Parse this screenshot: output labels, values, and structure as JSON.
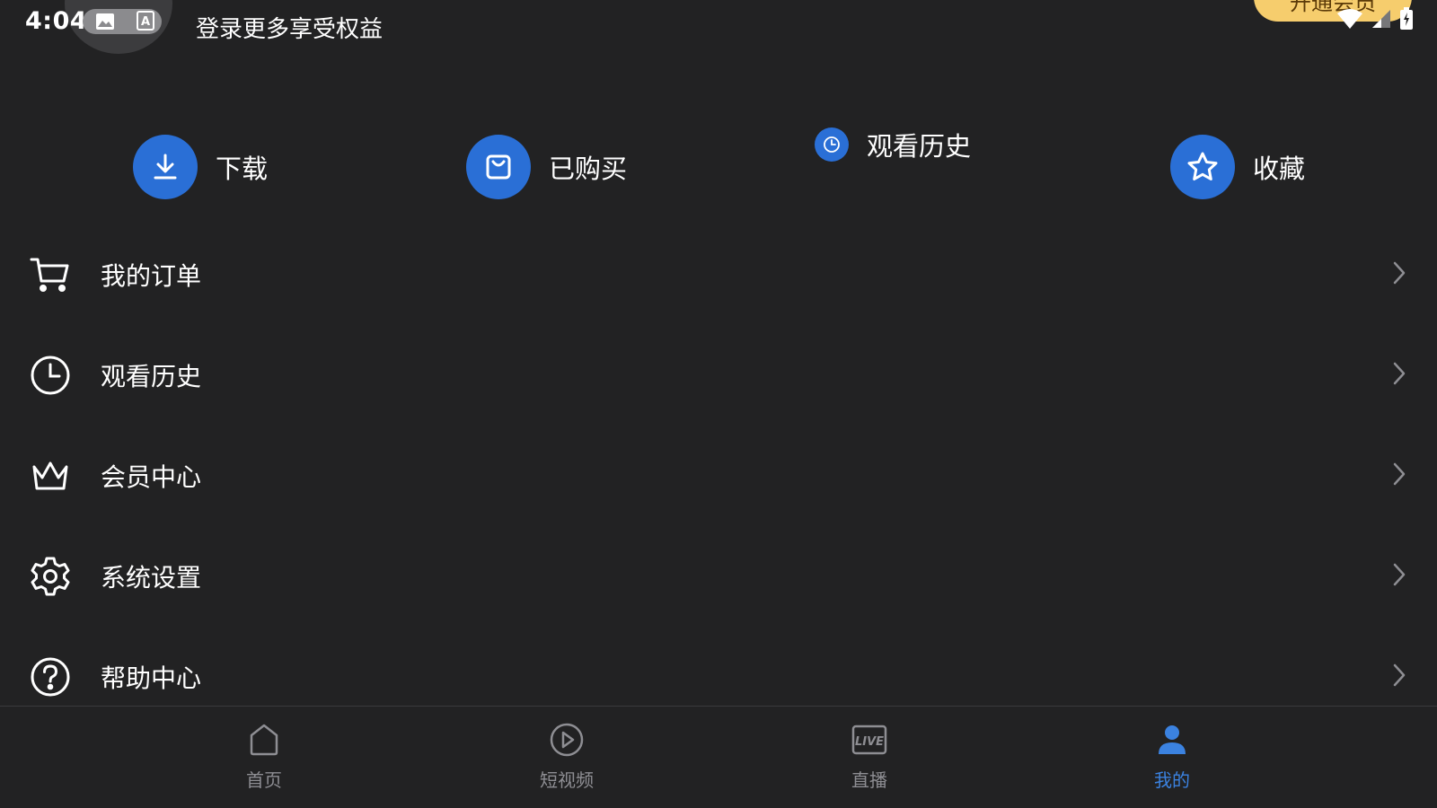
{
  "status_bar": {
    "time": "4:04"
  },
  "header": {
    "login_prompt": "登录更多享受权益",
    "vip_button": "开通会员"
  },
  "quick_actions": [
    {
      "label": "下载",
      "icon": "download-icon"
    },
    {
      "label": "已购买",
      "icon": "bag-icon"
    },
    {
      "label": "观看历史",
      "icon": "clock-icon"
    },
    {
      "label": "收藏",
      "icon": "star-icon"
    }
  ],
  "menu": [
    {
      "label": "我的订单",
      "icon": "cart-icon"
    },
    {
      "label": "观看历史",
      "icon": "clock-icon"
    },
    {
      "label": "会员中心",
      "icon": "crown-icon"
    },
    {
      "label": "系统设置",
      "icon": "gear-icon"
    },
    {
      "label": "帮助中心",
      "icon": "help-icon"
    }
  ],
  "bottom_nav": [
    {
      "label": "首页",
      "icon": "home-icon",
      "active": false
    },
    {
      "label": "短视频",
      "icon": "play-icon",
      "active": false
    },
    {
      "label": "直播",
      "icon": "live-icon",
      "active": false
    },
    {
      "label": "我的",
      "icon": "profile-icon",
      "active": true
    }
  ],
  "colors": {
    "background": "#222223",
    "accent": "#2a6fd6",
    "active_nav": "#3b82e0",
    "vip_gold": "#f6cd6d",
    "inactive_nav": "#8e8e93"
  }
}
